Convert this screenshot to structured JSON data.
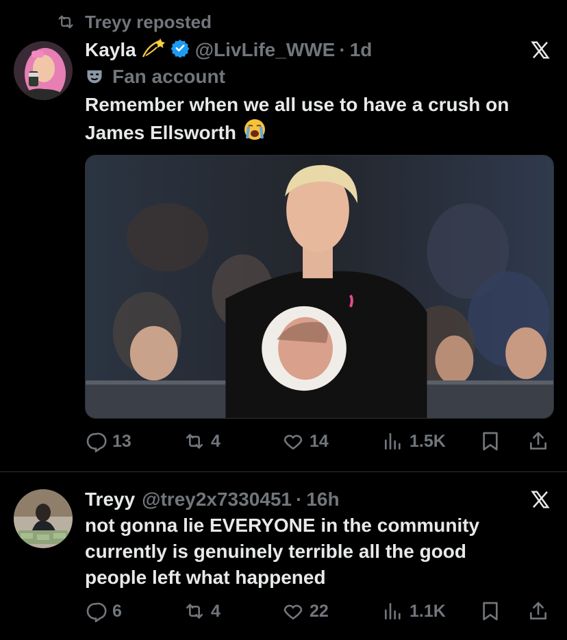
{
  "repost": {
    "label": "Treyy reposted"
  },
  "tweets": [
    {
      "name": "Kayla",
      "handle": "@LivLife_WWE",
      "separator": "·",
      "time": "1d",
      "label": "Fan account",
      "text_lines": [
        "Remember when we all use to have a crush on",
        "James Ellsworth"
      ],
      "name_emoji": "dizzy-emoji",
      "text_emoji": "loudly-crying-face-emoji",
      "verified": true,
      "stats": {
        "replies": "13",
        "reposts": "4",
        "likes": "14",
        "views": "1.5K"
      }
    },
    {
      "name": "Treyy",
      "handle": "@trey2x7330451",
      "separator": "·",
      "time": "16h",
      "text_lines": [
        "not gonna lie EVERYONE in the community",
        "currently is genuinely terrible all the good",
        "people left what happened"
      ],
      "stats": {
        "replies": "6",
        "reposts": "4",
        "likes": "22",
        "views": "1.1K"
      }
    }
  ],
  "colors": {
    "background": "#000000",
    "text": "#e7e9ea",
    "muted": "#71767b",
    "verified": "#1d9bf0",
    "divider": "#2f3336"
  },
  "icons": [
    "repost-icon",
    "verified-badge-icon",
    "x-logo-icon",
    "theater-mask-icon",
    "reply-icon",
    "retweet-icon",
    "like-icon",
    "views-icon",
    "bookmark-icon",
    "share-icon"
  ]
}
